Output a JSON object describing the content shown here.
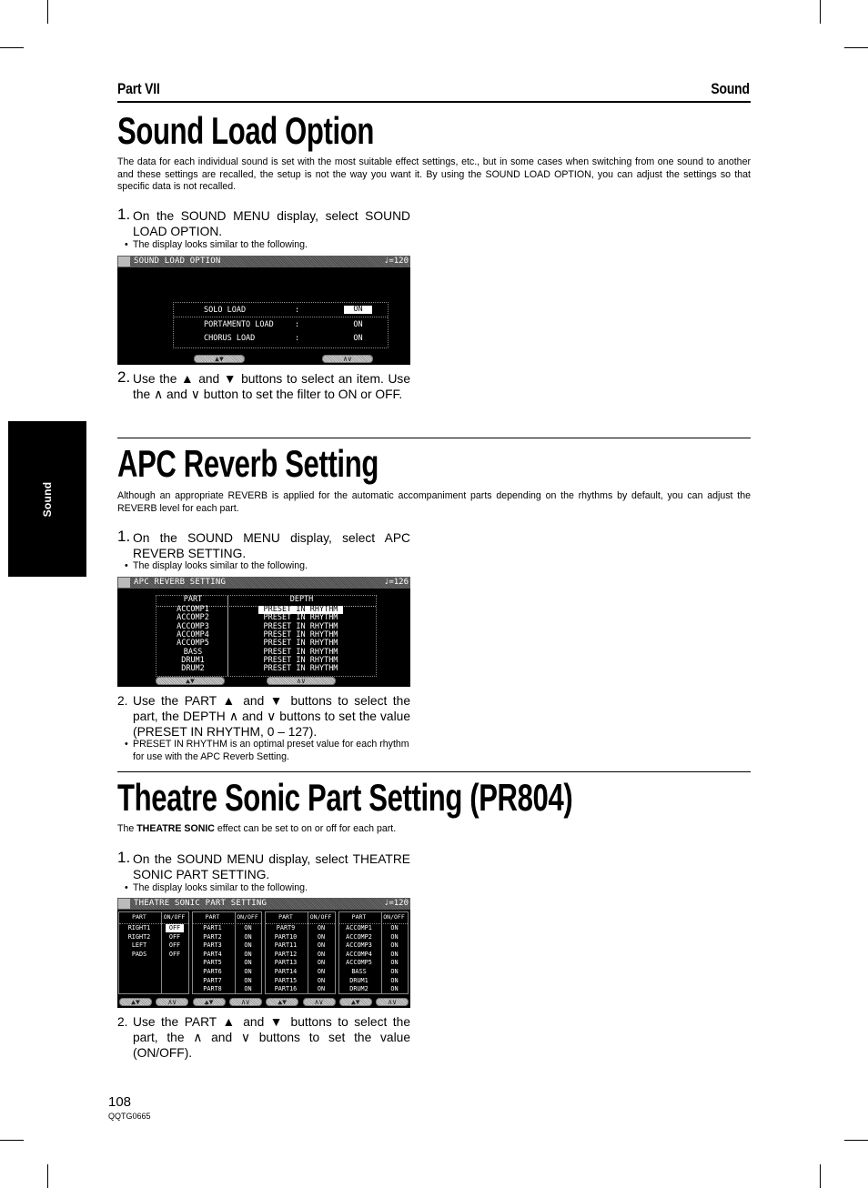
{
  "header": {
    "part": "Part VII",
    "section": "Sound"
  },
  "side_tab": "Sound",
  "sections": [
    {
      "title": "Sound Load Option",
      "intro": "The data for each individual sound is set with the most suitable effect settings, etc., but in some cases when switching from one sound to another and these settings are recalled, the setup is not the way you want it. By using the SOUND LOAD OPTION, you can adjust the settings so that specific data is not recalled.",
      "step1_num": "1.",
      "step1": "On the SOUND MENU display, select SOUND LOAD OPTION.",
      "bullet1": "The display looks similar to the following.",
      "display": {
        "icon": "sound-icon",
        "title": "SOUND LOAD OPTION",
        "tempo": "♩=120",
        "rows": [
          {
            "label": "SOLO LOAD",
            "sep": ":",
            "value": "ON",
            "selected": true
          },
          {
            "label": "PORTAMENTO LOAD",
            "sep": ":",
            "value": "ON",
            "selected": false
          },
          {
            "label": "CHORUS LOAD",
            "sep": ":",
            "value": "ON",
            "selected": false
          }
        ],
        "buttons": [
          "▲▼",
          "∧∨"
        ]
      },
      "step2_num": "2.",
      "step2": "Use the ▲ and ▼ buttons to select an item. Use the ∧ and ∨ button to set the filter to ON or OFF."
    },
    {
      "title": "APC Reverb Setting",
      "intro": "Although an appropriate REVERB is applied for the automatic accompaniment parts depending on the rhythms by default, you can adjust the REVERB level for each part.",
      "step1_num": "1.",
      "step1": "On the SOUND MENU display, select APC REVERB SETTING.",
      "bullet1": "The display looks similar to the following.",
      "display": {
        "icon": "sound-icon",
        "title": "APC REVERB SETTING",
        "tempo": "♩=126",
        "col_part": "PART",
        "col_depth": "DEPTH",
        "rows": [
          {
            "part": "ACCOMP1",
            "depth": "PRESET IN RHYTHM",
            "selected": true
          },
          {
            "part": "ACCOMP2",
            "depth": "PRESET IN RHYTHM"
          },
          {
            "part": "ACCOMP3",
            "depth": "PRESET IN RHYTHM"
          },
          {
            "part": "ACCOMP4",
            "depth": "PRESET IN RHYTHM"
          },
          {
            "part": "ACCOMP5",
            "depth": "PRESET IN RHYTHM"
          },
          {
            "part": "BASS",
            "depth": "PRESET IN RHYTHM"
          },
          {
            "part": "DRUM1",
            "depth": "PRESET IN RHYTHM"
          },
          {
            "part": "DRUM2",
            "depth": "PRESET IN RHYTHM"
          }
        ],
        "buttons": [
          "▲▼",
          "∧∨"
        ]
      },
      "step2_num": "2.",
      "step2": "Use the PART ▲ and ▼ buttons to select the part, the DEPTH ∧ and ∨ buttons to set the value (PRESET IN RHYTHM, 0 – 127).",
      "bullet2": "PRESET IN RHYTHM is an optimal preset value for each rhythm for use with the APC Reverb Setting."
    },
    {
      "title": "Theatre Sonic Part Setting (PR804)",
      "intro_pre": "The ",
      "intro_bold": "THEATRE SONIC",
      "intro_post": " effect can be set to on or off for each part.",
      "step1_num": "1.",
      "step1": "On the SOUND MENU display, select THEATRE SONIC PART SETTING.",
      "bullet1": "The display looks similar to the following.",
      "display": {
        "icon": "theatre-icon",
        "title": "THEATRE SONIC PART SETTING",
        "tempo": "♩=120",
        "col_part": "PART",
        "col_onoff": "ON/OFF",
        "groups": [
          {
            "rows": [
              {
                "part": "RIGHT1",
                "value": "OFF",
                "selected": true
              },
              {
                "part": "RIGHT2",
                "value": "OFF"
              },
              {
                "part": "LEFT",
                "value": "OFF"
              },
              {
                "part": "PADS",
                "value": "OFF"
              }
            ]
          },
          {
            "rows": [
              {
                "part": "PART1",
                "value": "ON"
              },
              {
                "part": "PART2",
                "value": "ON"
              },
              {
                "part": "PART3",
                "value": "ON"
              },
              {
                "part": "PART4",
                "value": "ON"
              },
              {
                "part": "PART5",
                "value": "ON"
              },
              {
                "part": "PART6",
                "value": "ON"
              },
              {
                "part": "PART7",
                "value": "ON"
              },
              {
                "part": "PART8",
                "value": "ON"
              }
            ]
          },
          {
            "rows": [
              {
                "part": "PART9",
                "value": "ON"
              },
              {
                "part": "PART10",
                "value": "ON"
              },
              {
                "part": "PART11",
                "value": "ON"
              },
              {
                "part": "PART12",
                "value": "ON"
              },
              {
                "part": "PART13",
                "value": "ON"
              },
              {
                "part": "PART14",
                "value": "ON"
              },
              {
                "part": "PART15",
                "value": "ON"
              },
              {
                "part": "PART16",
                "value": "ON"
              }
            ]
          },
          {
            "rows": [
              {
                "part": "ACCOMP1",
                "value": "ON"
              },
              {
                "part": "ACCOMP2",
                "value": "ON"
              },
              {
                "part": "ACCOMP3",
                "value": "ON"
              },
              {
                "part": "ACCOMP4",
                "value": "ON"
              },
              {
                "part": "ACCOMP5",
                "value": "ON"
              },
              {
                "part": "BASS",
                "value": "ON"
              },
              {
                "part": "DRUM1",
                "value": "ON"
              },
              {
                "part": "DRUM2",
                "value": "ON"
              }
            ]
          }
        ],
        "buttons": [
          "▲▼",
          "∧∨",
          "▲▼",
          "∧∨",
          "▲▼",
          "∧∨",
          "▲▼",
          "∧∨"
        ]
      },
      "step2_num": "2.",
      "step2": "Use the PART ▲ and ▼ buttons to select the part, the ∧ and ∨ buttons to set the value (ON/OFF)."
    }
  ],
  "footer": {
    "page_number": "108",
    "doc_code": "QQTG0665"
  }
}
